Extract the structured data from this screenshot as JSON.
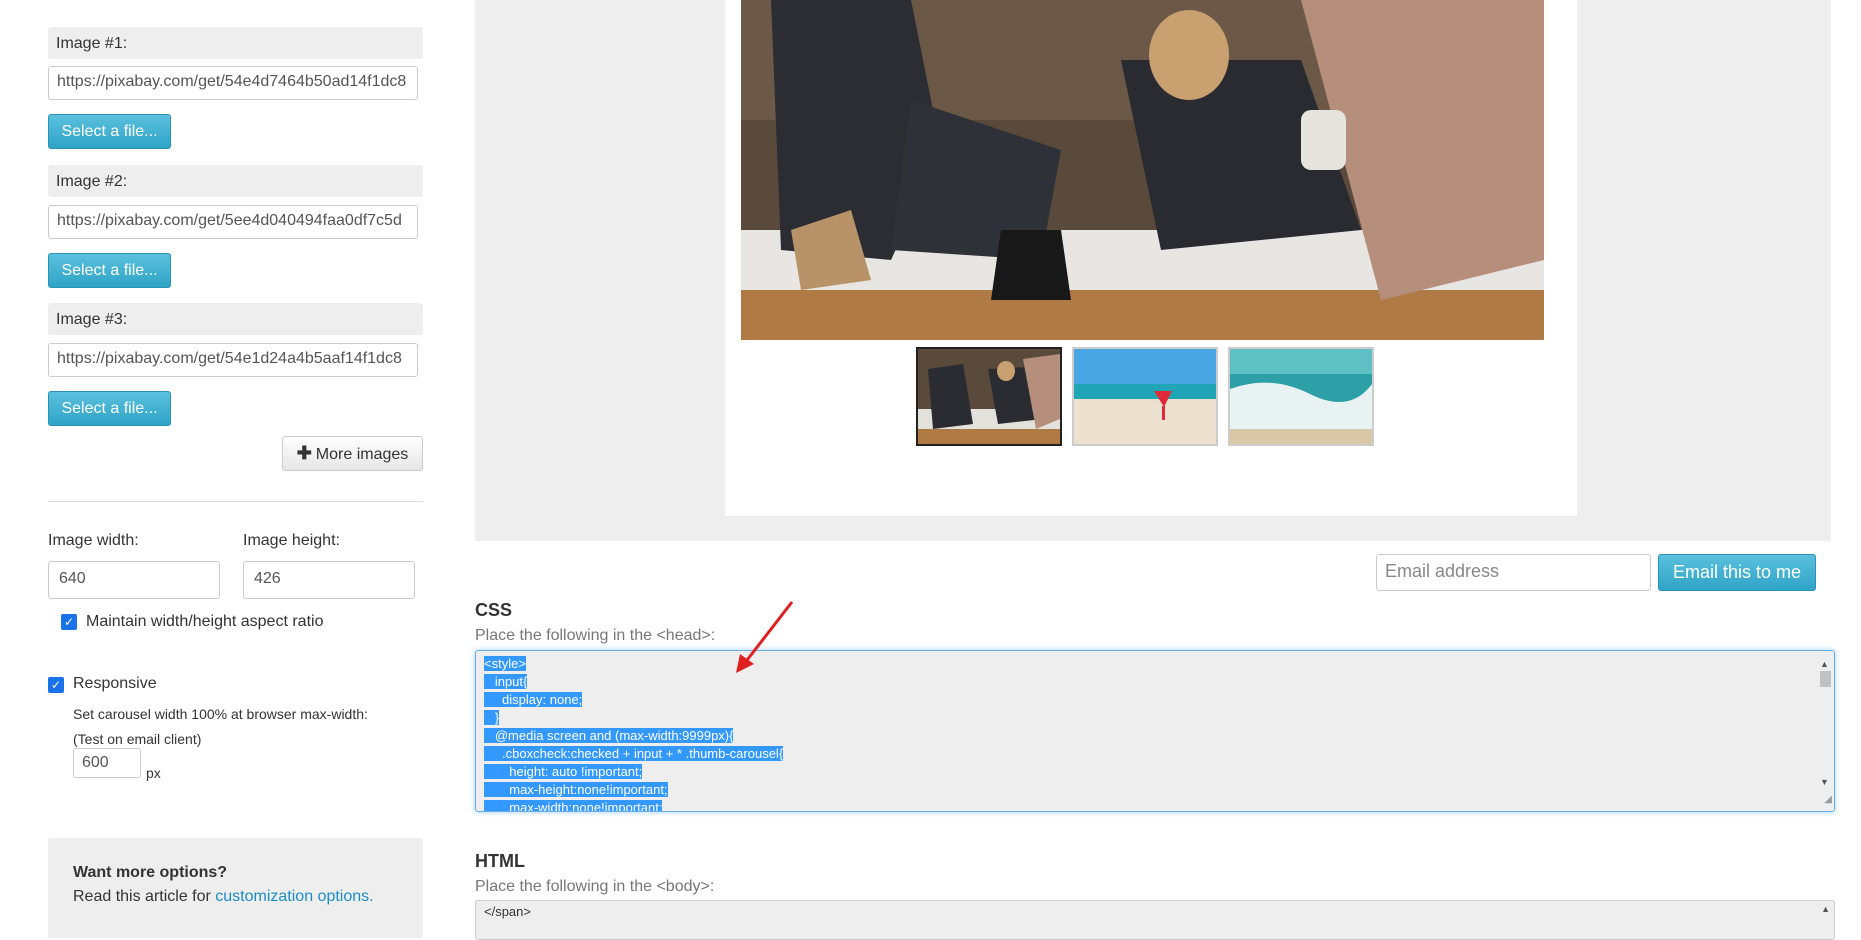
{
  "sidebar": {
    "images": [
      {
        "label": "Image #1:",
        "url": "https://pixabay.com/get/54e4d7464b50ad14f1dc8",
        "button": "Select a file..."
      },
      {
        "label": "Image #2:",
        "url": "https://pixabay.com/get/5ee4d040494faa0df7c5d",
        "button": "Select a file..."
      },
      {
        "label": "Image #3:",
        "url": "https://pixabay.com/get/54e1d24a4b5aaf14f1dc8",
        "button": "Select a file..."
      }
    ],
    "more_images_label": "More images",
    "image_width_label": "Image width:",
    "image_height_label": "Image height:",
    "image_width_value": "640",
    "image_height_value": "426",
    "aspect_ratio_label": "Maintain width/height aspect ratio",
    "aspect_ratio_checked": true,
    "responsive_label": "Responsive",
    "responsive_checked": true,
    "carousel_note_1": "Set carousel width 100% at browser max-width:",
    "carousel_note_2": "(Test on email client)",
    "max_width_value": "600",
    "max_width_unit": "px",
    "more_options": {
      "title": "Want more options?",
      "text": "Read this article for ",
      "link": "customization options."
    }
  },
  "preview": {
    "thumbnails": [
      "couple-with-pug",
      "beach-drink",
      "ocean-wave"
    ]
  },
  "email": {
    "placeholder": "Email address",
    "button": "Email this to me"
  },
  "css_section": {
    "title": "CSS",
    "subtitle": "Place the following in the <head>:",
    "code_lines": [
      "<style>",
      "   input{",
      "     display: none;",
      "   }",
      "   @media screen and (max-width:9999px){",
      "     .cboxcheck:checked + input + * .thumb-carousel{",
      "       height: auto !important;",
      "       max-height:none!important;",
      "       max-width:none!important;"
    ]
  },
  "html_section": {
    "title": "HTML",
    "subtitle": "Place the following in the <body>:",
    "code_first_line": "</span>"
  },
  "colors": {
    "accent": "#2fa4c7",
    "selection": "#3399ff",
    "link": "#1a8dc7",
    "annotation_arrow": "#e02020"
  }
}
